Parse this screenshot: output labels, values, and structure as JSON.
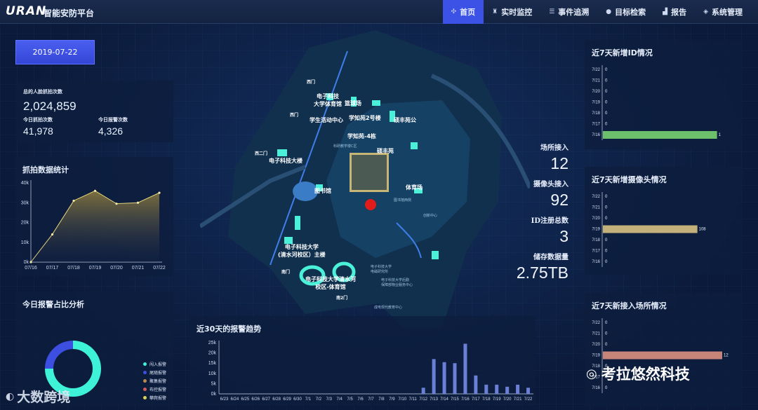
{
  "header": {
    "logo": "URAN",
    "subtitle": "智能安防平台",
    "nav": [
      {
        "label": "首页",
        "icon": "dashboard-icon",
        "active": true
      },
      {
        "label": "实时监控",
        "icon": "camera-icon",
        "active": false
      },
      {
        "label": "事件追溯",
        "icon": "list-icon",
        "active": false
      },
      {
        "label": "目标检索",
        "icon": "user-icon",
        "active": false
      },
      {
        "label": "报告",
        "icon": "chart-icon",
        "active": false
      },
      {
        "label": "系统管理",
        "icon": "layers-icon",
        "active": false
      }
    ]
  },
  "date_button": "2019-07-22",
  "face_stats": {
    "total_label": "总的人脸抓拍次数",
    "total_value": "2,024,859",
    "today_capture_label": "今日抓拍次数",
    "today_capture_value": "41,978",
    "today_alarm_label": "今日报警次数",
    "today_alarm_value": "4,326"
  },
  "capture_stats": {
    "title": "抓拍数据统计"
  },
  "alarm_ratio": {
    "title": "今日报警占比分析",
    "legend": [
      {
        "label": "闯入报警",
        "color": "#3ef2d8"
      },
      {
        "label": "尾随报警",
        "color": "#3c4fe0"
      },
      {
        "label": "聚集报警",
        "color": "#b98a4c"
      },
      {
        "label": "布控报警",
        "color": "#d25a5a"
      },
      {
        "label": "攀爬报警",
        "color": "#d8d25a"
      }
    ]
  },
  "trend": {
    "title": "近30天的报警趋势"
  },
  "map": {
    "labels": [
      {
        "text": "电子科技\n大学体育馆"
      },
      {
        "text": "篮球场"
      },
      {
        "text": "学生活动中心"
      },
      {
        "text": "学知苑2号楼"
      },
      {
        "text": "硕丰苑公"
      },
      {
        "text": "学知苑-4栋"
      },
      {
        "text": "硕丰苑"
      },
      {
        "text": "图书馆"
      },
      {
        "text": "体育场"
      },
      {
        "text": "电子科技大学\n(清水河校区）主楼"
      },
      {
        "text": "电子科技大学清水河\n校区-体育馆"
      },
      {
        "text": "电子科技大楼"
      },
      {
        "text": "西门"
      },
      {
        "text": "西二门"
      },
      {
        "text": "西门"
      },
      {
        "text": "南门"
      },
      {
        "text": "南2门"
      }
    ],
    "small_labels": [
      "成电现代教育中心",
      "电子科技大学\n电磁研究所",
      "电子科技大学后勤\n保障部物业服务中心",
      "科研教学楼C区",
      "创新中心",
      "图书馆西侧"
    ]
  },
  "site_stats": {
    "venue_label": "场所接入",
    "venue_value": "12",
    "camera_label": "摄像头接入",
    "camera_value": "92",
    "id_label": "ID注册总数",
    "id_value": "3",
    "storage_label": "储存数据量",
    "storage_value": "2.75TB"
  },
  "chart_data": [
    {
      "type": "area",
      "title": "抓拍数据统计",
      "categories": [
        "07/16",
        "07/17",
        "07/18",
        "07/19",
        "07/20",
        "07/21",
        "07/22"
      ],
      "values": [
        0,
        14000,
        31000,
        36000,
        29500,
        30000,
        35000
      ],
      "yticks": [
        "0k",
        "10k",
        "20k",
        "30k",
        "40k"
      ],
      "ylim": [
        0,
        40000
      ],
      "colors": {
        "line": "#e4d27a",
        "fill_top": "#8a7a3e"
      }
    },
    {
      "type": "pie",
      "title": "今日报警占比分析",
      "categories": [
        "闯入报警",
        "尾随报警",
        "聚集报警",
        "布控报警",
        "攀爬报警"
      ],
      "values": [
        75,
        25,
        0,
        0,
        0
      ],
      "donut": true
    },
    {
      "type": "bar",
      "title": "近30天的报警趋势",
      "categories": [
        "6/23",
        "6/24",
        "6/25",
        "6/26",
        "6/27",
        "6/28",
        "6/29",
        "6/30",
        "7/1",
        "7/2",
        "7/3",
        "7/4",
        "7/5",
        "7/6",
        "7/7",
        "7/8",
        "7/9",
        "7/10",
        "7/11",
        "7/12",
        "7/13",
        "7/14",
        "7/15",
        "7/16",
        "7/17",
        "7/18",
        "7/19",
        "7/20",
        "7/21",
        "7/22"
      ],
      "values": [
        0,
        0,
        0,
        0,
        0,
        0,
        0,
        0,
        0,
        0,
        0,
        0,
        0,
        0,
        0,
        0,
        0,
        0,
        0,
        3000,
        17000,
        15500,
        15000,
        24500,
        9000,
        4500,
        4500,
        3500,
        4500,
        3000
      ],
      "yticks": [
        "0k",
        "5k",
        "10k",
        "15k",
        "20k",
        "25k"
      ],
      "ylim": [
        0,
        25000
      ],
      "color": "#6b7fd6"
    },
    {
      "type": "bar",
      "orientation": "horizontal",
      "title": "近7天新增ID情况",
      "categories": [
        "7/22",
        "7/21",
        "7/20",
        "7/19",
        "7/18",
        "7/17",
        "7/16"
      ],
      "values": [
        0,
        0,
        0,
        0,
        0,
        0,
        1
      ],
      "xlim": [
        0,
        1.15
      ],
      "color": "#6cc06c"
    },
    {
      "type": "bar",
      "orientation": "horizontal",
      "title": "近7天新增摄像头情况",
      "categories": [
        "7/22",
        "7/21",
        "7/20",
        "7/19",
        "7/18",
        "7/17",
        "7/16"
      ],
      "values": [
        0,
        0,
        0,
        108,
        0,
        0,
        0
      ],
      "xlim": [
        0,
        150
      ],
      "color": "#c4b07a"
    },
    {
      "type": "bar",
      "orientation": "horizontal",
      "title": "近7天新接入场所情况",
      "categories": [
        "7/22",
        "7/21",
        "7/20",
        "7/19",
        "7/18",
        "7/17",
        "7/16"
      ],
      "values": [
        0,
        0,
        0,
        12,
        0,
        0,
        0
      ],
      "xlim": [
        0,
        13.2
      ],
      "color": "#c7857a"
    }
  ],
  "watermark": "考拉悠然科技",
  "watermark2": "大数跨境"
}
